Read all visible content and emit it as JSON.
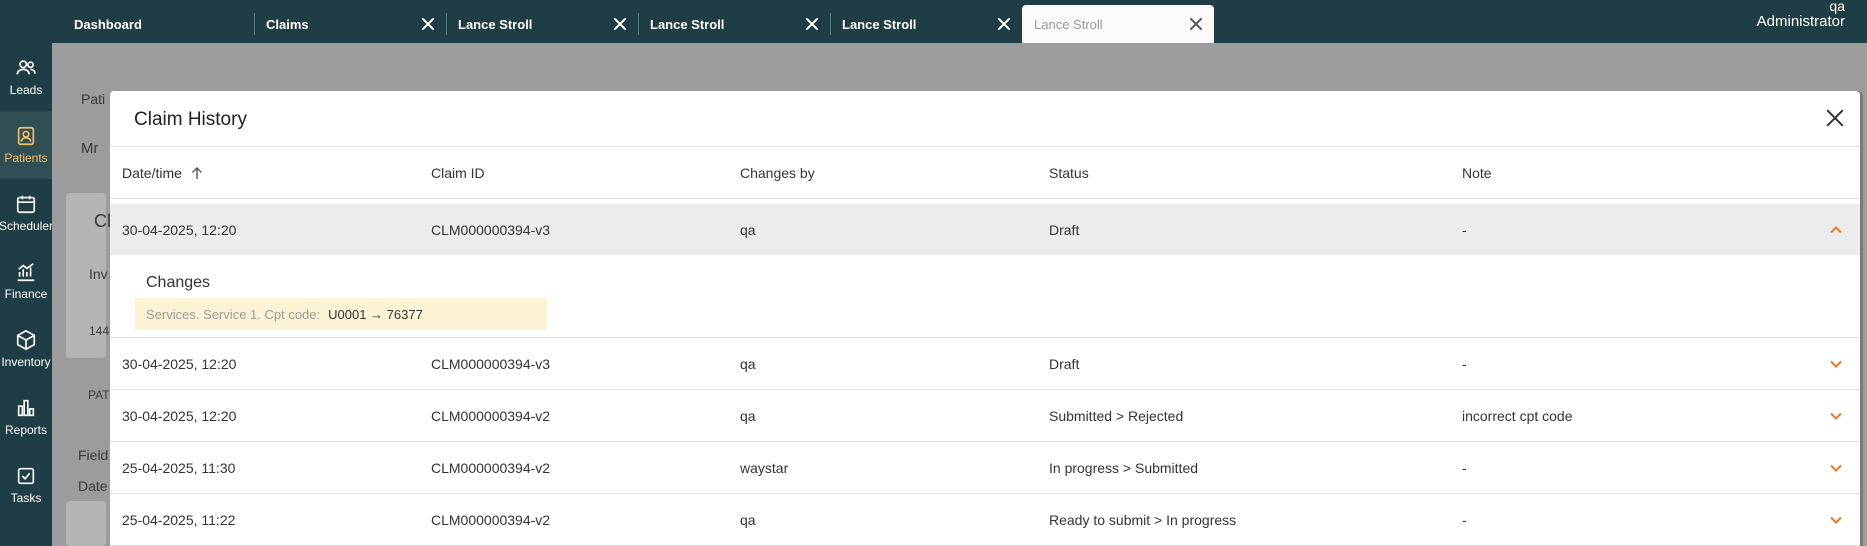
{
  "tabs": [
    {
      "label": "Dashboard",
      "closable": false,
      "active": false
    },
    {
      "label": "Claims",
      "closable": true,
      "active": false
    },
    {
      "label": "Lance Stroll",
      "closable": true,
      "active": false
    },
    {
      "label": "Lance Stroll",
      "closable": true,
      "active": false
    },
    {
      "label": "Lance Stroll",
      "closable": true,
      "active": false
    },
    {
      "label": "Lance Stroll",
      "closable": true,
      "active": true
    }
  ],
  "user": {
    "name": "qa",
    "role": "Administrator"
  },
  "sidebar": {
    "items": [
      {
        "label": "Leads",
        "icon": "people-icon"
      },
      {
        "label": "Patients",
        "icon": "patient-card-icon",
        "active": true
      },
      {
        "label": "Scheduler",
        "icon": "calendar-icon"
      },
      {
        "label": "Finance",
        "icon": "chart-trend-icon"
      },
      {
        "label": "Inventory",
        "icon": "box-icon"
      },
      {
        "label": "Reports",
        "icon": "bar-chart-icon"
      },
      {
        "label": "Tasks",
        "icon": "checkbox-icon"
      }
    ]
  },
  "background": {
    "t1": "Pati",
    "t2": "Mr",
    "t3": "Cl",
    "t4": "Inv",
    "t5": "144",
    "t6": "PAT",
    "t7": "Field",
    "t8": "Date"
  },
  "modal": {
    "title": "Claim History",
    "columns": {
      "datetime": "Date/time",
      "claim_id": "Claim ID",
      "changes_by": "Changes by",
      "status": "Status",
      "note": "Note"
    },
    "rows": [
      {
        "datetime": "30-04-2025, 12:20",
        "claim_id": "CLM000000394-v3",
        "changes_by": "qa",
        "status": "Draft",
        "note": "-"
      },
      {
        "datetime": "30-04-2025, 12:20",
        "claim_id": "CLM000000394-v3",
        "changes_by": "qa",
        "status": "Draft",
        "note": "-"
      },
      {
        "datetime": "30-04-2025, 12:20",
        "claim_id": "CLM000000394-v2",
        "changes_by": "qa",
        "status": "Submitted > Rejected",
        "note": "incorrect cpt code"
      },
      {
        "datetime": "25-04-2025, 11:30",
        "claim_id": "CLM000000394-v2",
        "changes_by": "waystar",
        "status": "In progress > Submitted",
        "note": "-"
      },
      {
        "datetime": "25-04-2025, 11:22",
        "claim_id": "CLM000000394-v2",
        "changes_by": "qa",
        "status": "Ready to submit > In progress",
        "note": "-"
      }
    ],
    "changes": {
      "title": "Changes",
      "field": "Services. Service 1. Cpt code:",
      "value": "U0001 → 76377"
    }
  },
  "colors": {
    "accent": "#e8782a",
    "sidebar": "#1f3d44",
    "active_nav": "#f1c069",
    "change_highlight": "#fbf3d4"
  }
}
